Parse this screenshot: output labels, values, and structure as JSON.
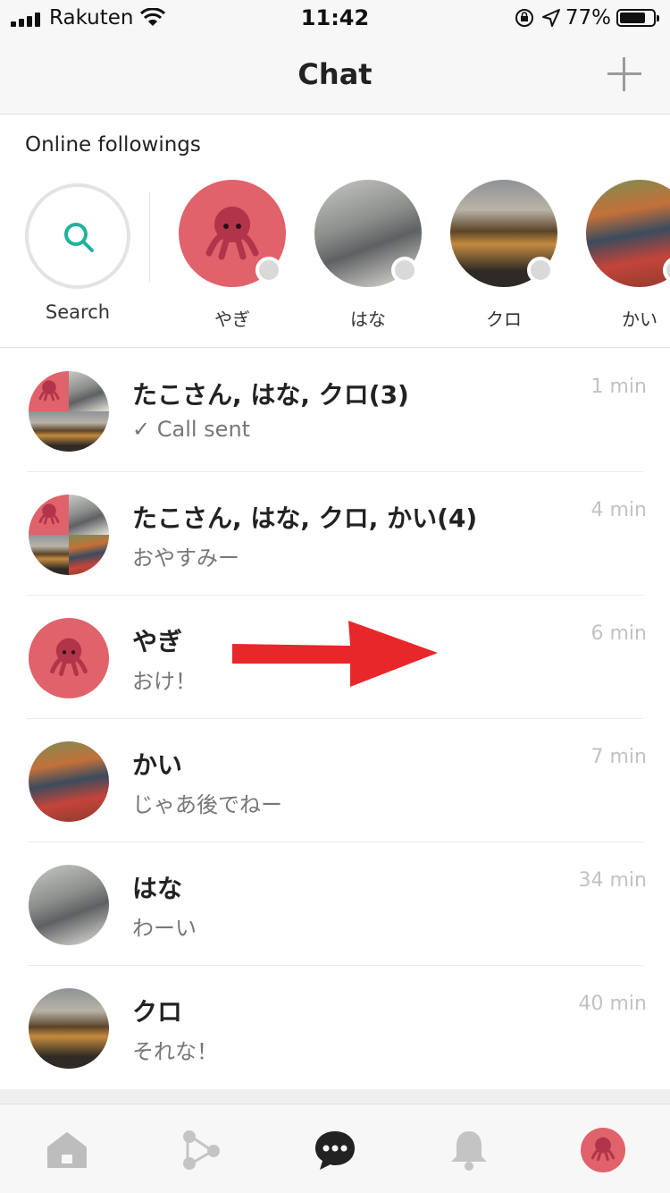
{
  "status_bar": {
    "carrier": "Rakuten",
    "time": "11:42",
    "battery": "77%",
    "battery_level": 0.77
  },
  "header": {
    "title": "Chat",
    "add_icon": "plus-icon"
  },
  "online": {
    "heading": "Online followings",
    "search_label": "Search",
    "people": [
      {
        "name": "やぎ",
        "avatar": "octopus"
      },
      {
        "name": "はな",
        "avatar": "photo-hana"
      },
      {
        "name": "クロ",
        "avatar": "photo-kuro"
      },
      {
        "name": "かい",
        "avatar": "photo-kai"
      }
    ]
  },
  "chats": [
    {
      "name": "たこさん, はな, クロ(3)",
      "message": "✓ Call sent",
      "time": "1 min"
    },
    {
      "name": "たこさん, はな, クロ, かい(4)",
      "message": "おやすみー",
      "time": "4 min"
    },
    {
      "name": "やぎ",
      "message": "おけ！",
      "time": "6 min"
    },
    {
      "name": "かい",
      "message": "じゃあ後でねー",
      "time": "7 min"
    },
    {
      "name": "はな",
      "message": "わーい",
      "time": "34 min"
    },
    {
      "name": "クロ",
      "message": "それな！",
      "time": "40 min"
    }
  ],
  "colors": {
    "accent_teal": "#1fb39b",
    "avatar_pink": "#e0626a",
    "annotation_red": "#e8272a"
  },
  "tabs": [
    "home-icon",
    "connections-icon",
    "chat-icon",
    "bell-icon",
    "profile-avatar"
  ]
}
